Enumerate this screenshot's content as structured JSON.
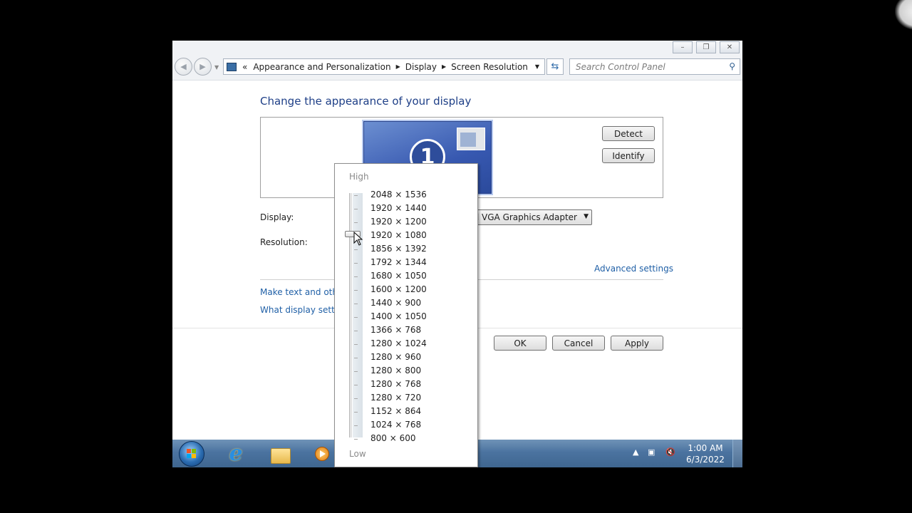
{
  "window": {
    "caption_buttons": [
      "minimize",
      "restore",
      "close"
    ]
  },
  "address_bar": {
    "chevron": "«",
    "breadcrumbs": [
      "Appearance and Personalization",
      "Display",
      "Screen Resolution"
    ]
  },
  "search": {
    "placeholder": "Search Control Panel"
  },
  "main": {
    "heading": "Change the appearance of your display",
    "monitor_number": "1",
    "detect_label": "Detect",
    "identify_label": "Identify",
    "display_label": "Display:",
    "display_value": "1. Standard VGA Graphics Adapter",
    "display_visible": "lard VGA Graphics Adapter",
    "resolution_label": "Resolution:",
    "advanced_link": "Advanced settings",
    "link_text_size_partial": "Make text and other",
    "link_display_settings_partial": "What display setting",
    "ok_label": "OK",
    "cancel_label": "Cancel",
    "apply_label": "Apply"
  },
  "resolution_popup": {
    "high_label": "High",
    "low_label": "Low",
    "options": [
      "2048 × 1536",
      "1920 × 1440",
      "1920 × 1200",
      "1920 × 1080",
      "1856 × 1392",
      "1792 × 1344",
      "1680 × 1050",
      "1600 × 1200",
      "1440 × 900",
      "1400 × 1050",
      "1366 × 768",
      "1280 × 1024",
      "1280 × 960",
      "1280 × 800",
      "1280 × 768",
      "1280 × 720",
      "1152 × 864",
      "1024 × 768",
      "800 × 600"
    ],
    "selected": "1920 × 1080"
  },
  "taskbar": {
    "pinned": [
      "windows-start",
      "internet-explorer",
      "windows-explorer",
      "windows-media-player"
    ],
    "tray_icons": [
      "show-hidden-icons",
      "network-icon",
      "volume-muted-icon"
    ],
    "time": "1:00 AM",
    "date": "6/3/2022"
  },
  "colors": {
    "heading_blue": "#1e3f87",
    "link_blue": "#1f5fa6",
    "taskbar": "#4b73a0",
    "monitor": "#3758b0"
  }
}
